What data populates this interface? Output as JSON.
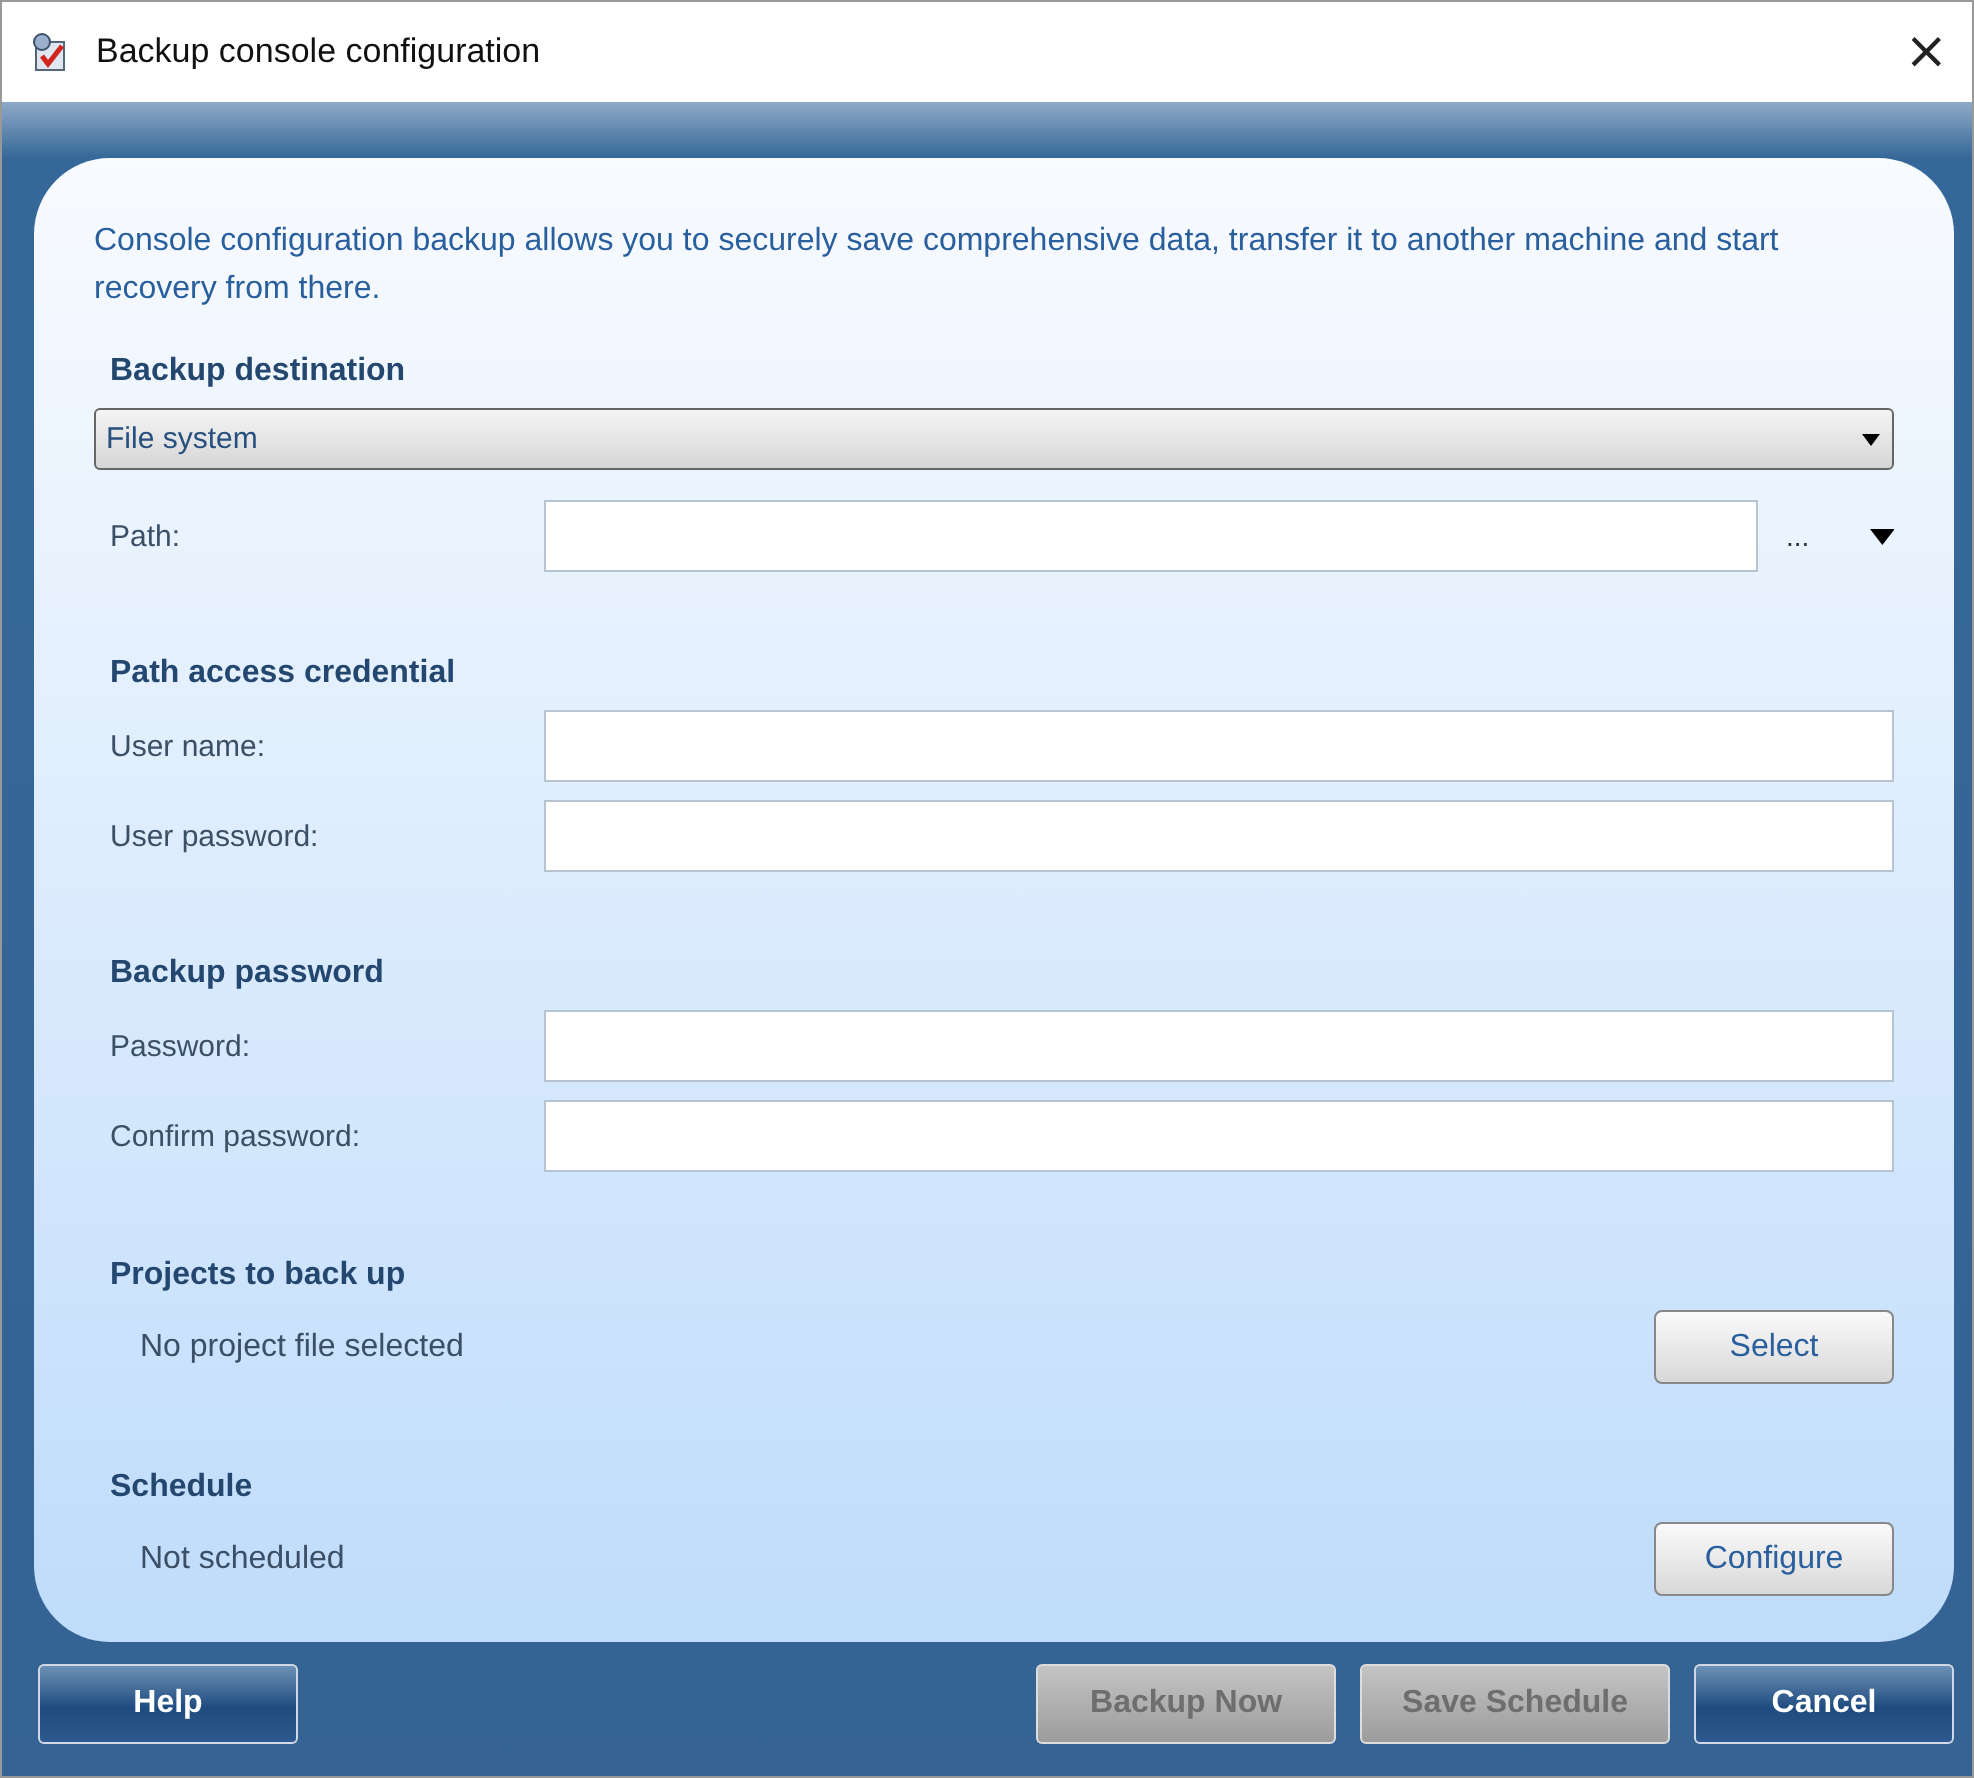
{
  "window": {
    "title": "Backup console configuration",
    "close": "×"
  },
  "description": "Console configuration backup allows you to securely save comprehensive data, transfer it to another machine and start recovery from there.",
  "destination": {
    "heading": "Backup destination",
    "value": "File system",
    "path_label": "Path:",
    "browse": "..."
  },
  "sections": [
    {
      "heading": "Path access credential",
      "fields": [
        {
          "label": "User name:"
        },
        {
          "label": "User password:"
        }
      ]
    },
    {
      "heading": "Backup password",
      "fields": [
        {
          "label": "Password:"
        },
        {
          "label": "Confirm password:"
        }
      ]
    }
  ],
  "actions": [
    {
      "heading": "Projects to back up",
      "status": "No project file selected",
      "button": "Select"
    },
    {
      "heading": "Schedule",
      "status": "Not scheduled",
      "button": "Configure"
    }
  ],
  "left_buttons": [
    {
      "label": "Help",
      "disabled": false
    }
  ],
  "right_buttons": [
    {
      "label": "Backup Now",
      "disabled": true
    },
    {
      "label": "Save Schedule",
      "disabled": true
    },
    {
      "label": "Cancel",
      "disabled": false
    }
  ]
}
